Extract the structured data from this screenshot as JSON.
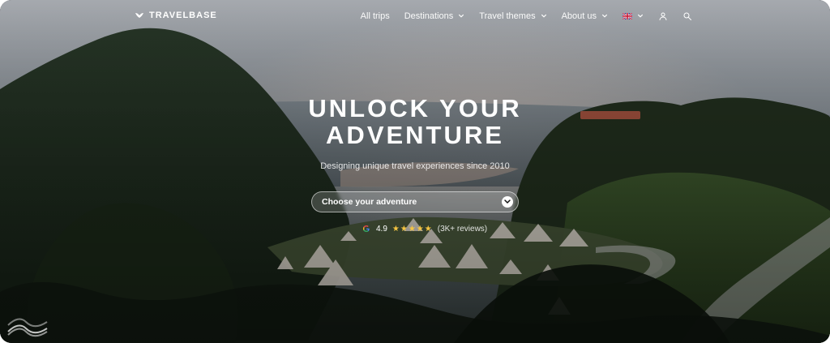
{
  "brand": {
    "name": "TRAVELBASE"
  },
  "nav": {
    "items": [
      {
        "label": "All trips",
        "has_dropdown": false
      },
      {
        "label": "Destinations",
        "has_dropdown": true
      },
      {
        "label": "Travel themes",
        "has_dropdown": true
      },
      {
        "label": "About us",
        "has_dropdown": true
      }
    ],
    "language_icon": "uk-flag",
    "icons": [
      "chevron-down-icon",
      "user-icon",
      "search-icon"
    ]
  },
  "hero": {
    "title_line1": "UNLOCK YOUR",
    "title_line2": "ADVENTURE",
    "subtitle": "Designing unique travel experiences since 2010",
    "search": {
      "placeholder": "Choose your adventure"
    },
    "rating": {
      "value": "4.9",
      "stars": "★★★★★",
      "reviews_text": "(3K+ reviews)"
    }
  },
  "colors": {
    "accent": "#ffffff",
    "star": "#f5c542"
  }
}
